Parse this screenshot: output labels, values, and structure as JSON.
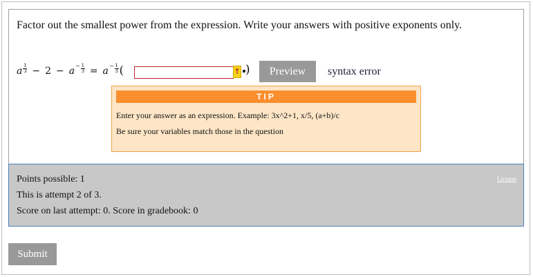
{
  "question": {
    "prompt": "Factor out the smallest power from the expression. Write your answers with positive exponents only.",
    "expression": {
      "base": "a",
      "exp_num": "1",
      "exp_den": "3",
      "minus": "−",
      "two": "2",
      "neg": "−",
      "equals": "=",
      "open_paren": "(",
      "close_paren": ")"
    },
    "answer": {
      "value": "",
      "placeholder": ""
    },
    "error_flag": "↑",
    "preview_label": "Preview",
    "status": "syntax error"
  },
  "tip": {
    "title": "TIP",
    "line1": "Enter your answer as an expression. Example: 3x^2+1, x/5, (a+b)/c",
    "line2": "Be sure your variables match those in the question"
  },
  "info": {
    "points": "Points possible: 1",
    "attempt": "This is attempt 2 of 3.",
    "score": "Score on last attempt: 0. Score in gradebook: 0",
    "license": "License"
  },
  "submit_label": "Submit",
  "colors": {
    "button_gray": "#999999",
    "tip_orange": "#fb8f2e",
    "tip_bg": "#fde5c6",
    "info_bg": "#c8c8c8",
    "error_red": "#c0262c"
  }
}
